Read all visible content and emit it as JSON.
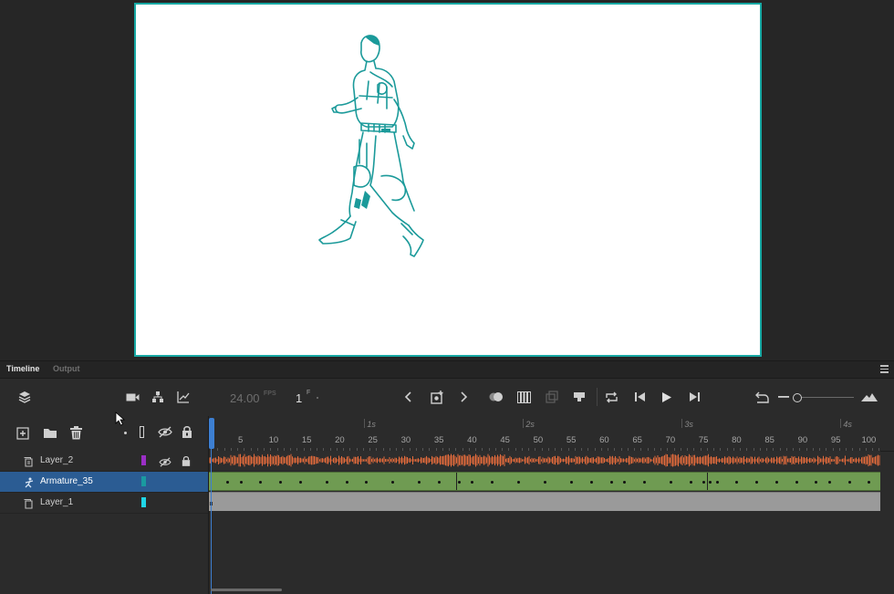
{
  "panel": {
    "tabs": [
      "Timeline",
      "Output"
    ],
    "active_tab": "Timeline"
  },
  "toolbar": {
    "fps_value": "24.00",
    "fps_unit": "FPS",
    "frame_value": "1",
    "frame_unit": "F"
  },
  "ruler": {
    "seconds": [
      "1s",
      "2s",
      "3s",
      "4s"
    ],
    "frame_numbers": [
      "5",
      "10",
      "15",
      "20",
      "25",
      "30",
      "35",
      "40",
      "45",
      "50",
      "55",
      "60",
      "65",
      "70",
      "75",
      "80",
      "85",
      "90",
      "95",
      "100"
    ]
  },
  "layers": [
    {
      "name": "Layer_2",
      "color": "#9b2fc6",
      "type": "audio",
      "selected": false
    },
    {
      "name": "Armature_35",
      "color": "#1a9aa0",
      "type": "armature",
      "selected": true
    },
    {
      "name": "Layer_1",
      "color": "#20d6e8",
      "type": "normal",
      "selected": false
    }
  ],
  "icons": {
    "header_left": [
      "layers-icon"
    ],
    "header_right": [
      "camera-icon",
      "layer-parenting-icon",
      "graph-icon"
    ],
    "layer_actions": [
      "new-layer-icon",
      "new-folder-icon",
      "delete-icon"
    ],
    "layer_columns": [
      "highlight-dot-icon",
      "outline-icon",
      "eye-hidden-icon",
      "lock-icon"
    ],
    "playback": [
      "prev-keyframe-icon",
      "insert-keyframe-icon",
      "next-keyframe-icon",
      "onion-skin-icon",
      "edit-multiple-frames-icon",
      "onion-range-icon",
      "center-frame-icon",
      "loop-icon",
      "step-back-icon",
      "play-icon",
      "step-forward-icon",
      "undo-icon",
      "zoom-out-icon",
      "zoom-in-icon"
    ]
  },
  "colors": {
    "stage_border": "#17a8a3",
    "armature_span": "#6f9b52",
    "layer1_span": "#9a9a9a",
    "audio_wave": "#e36b3c",
    "playhead": "#3d7fd2",
    "selection": "#2b5c93"
  }
}
